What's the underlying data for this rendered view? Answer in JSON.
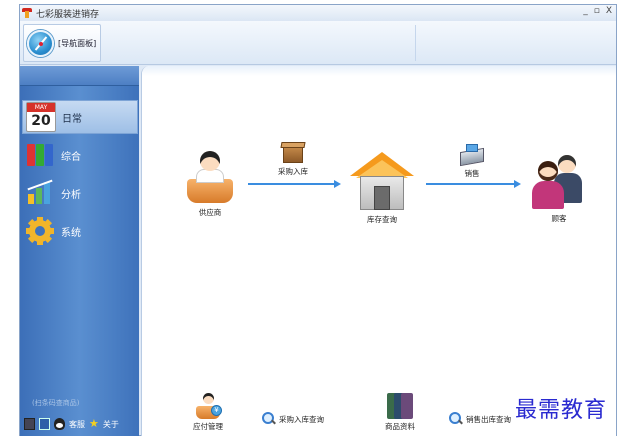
{
  "window": {
    "title": "七彩服装进销存",
    "controls": [
      "_",
      "▫",
      "X"
    ]
  },
  "ribbon": {
    "nav_tab_label": "[导航面板]"
  },
  "sidebar": {
    "items": [
      {
        "label": "日常",
        "icon": "calendar-icon",
        "active": true
      },
      {
        "label": "综合",
        "icon": "binders-icon",
        "active": false
      },
      {
        "label": "分析",
        "icon": "chart-icon",
        "active": false
      },
      {
        "label": "系统",
        "icon": "gear-icon",
        "active": false
      }
    ],
    "calendar_month": "MAY",
    "calendar_day": "20",
    "hint": "(扫条码查商品)",
    "bottom": {
      "service_label": "客服",
      "about_label": "关于"
    }
  },
  "flow": {
    "supplier": "供应商",
    "purchase_in": "采购入库",
    "inventory": "库存查询",
    "sales": "销售",
    "customers": "顾客"
  },
  "bottom_links": {
    "payables": "应付管理",
    "purchase_query": "采购入库查询",
    "product_data": "商品资料",
    "sales_query": "销售出库查询"
  },
  "watermark": "最需教育"
}
